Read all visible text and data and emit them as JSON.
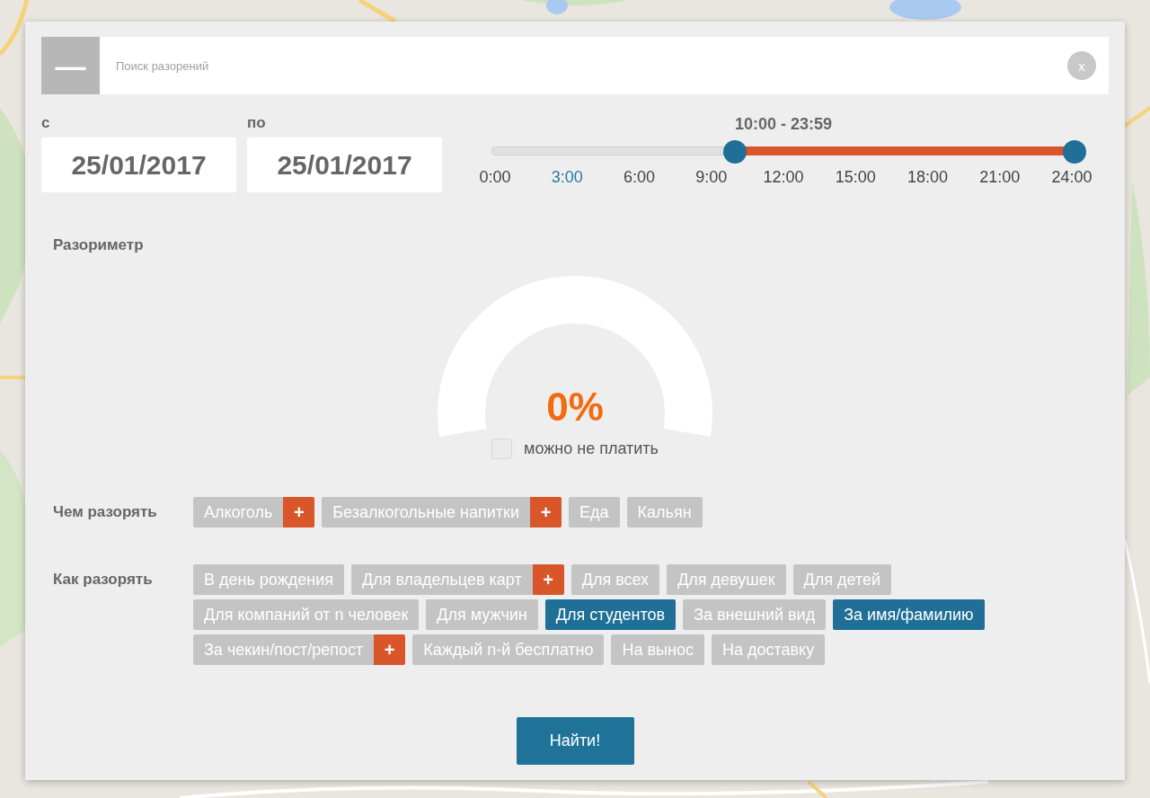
{
  "search": {
    "toggle": "—",
    "placeholder": "Поиск разорений",
    "close": "x"
  },
  "dates": [
    {
      "label": "с",
      "value": "25/01/2017"
    },
    {
      "label": "по",
      "value": "25/01/2017"
    }
  ],
  "time_range": {
    "reading": "10:00 - 23:59",
    "thumbs": [
      {
        "level": 0.417
      },
      {
        "level": 1
      }
    ],
    "ticks": [
      {
        "label": "0:00",
        "selected": false
      },
      {
        "label": "3:00",
        "selected": true
      },
      {
        "label": "6:00",
        "selected": false
      },
      {
        "label": "9:00",
        "selected": false
      },
      {
        "label": "12:00",
        "selected": false
      },
      {
        "label": "15:00",
        "selected": false
      },
      {
        "label": "18:00",
        "selected": false
      },
      {
        "label": "21:00",
        "selected": false
      },
      {
        "label": "24:00",
        "selected": false
      }
    ]
  },
  "meter": {
    "title": "Разориметр",
    "reading": "0%",
    "free": {
      "label": "можно не платить",
      "checked": false
    }
  },
  "groups": [
    {
      "title": "Чем разорять",
      "tags": [
        {
          "label": "Алкоголь",
          "selected": false,
          "add": "+"
        },
        {
          "label": "Безалкогольные напитки",
          "selected": false,
          "add": "+"
        },
        {
          "label": "Еда",
          "selected": false
        },
        {
          "label": "Кальян",
          "selected": false
        }
      ]
    },
    {
      "title": "Как разорять",
      "tags": [
        {
          "label": "В день рождения",
          "selected": false
        },
        {
          "label": "Для владельцев карт",
          "selected": false,
          "add": "+"
        },
        {
          "label": "Для всех",
          "selected": false
        },
        {
          "label": "Для девушек",
          "selected": false
        },
        {
          "label": "Для детей",
          "selected": false
        },
        {
          "label": "Для компаний от n человек",
          "selected": false
        },
        {
          "label": "Для мужчин",
          "selected": false
        },
        {
          "label": "Для студентов",
          "selected": true
        },
        {
          "label": "За внешний вид",
          "selected": false
        },
        {
          "label": "За имя/фамилию",
          "selected": true
        },
        {
          "label": "За чекин/пост/репост",
          "selected": false,
          "add": "+"
        },
        {
          "label": "Каждый n-й бесплатно",
          "selected": false
        },
        {
          "label": "На вынос",
          "selected": false
        },
        {
          "label": "На доставку",
          "selected": false
        }
      ]
    }
  ],
  "submit": "Найти!"
}
